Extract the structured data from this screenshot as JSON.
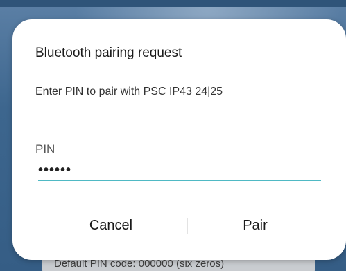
{
  "dialog": {
    "title": "Bluetooth pairing request",
    "message": "Enter PIN to pair with PSC IP43 24|25",
    "pin_label": "PIN",
    "pin_value": "••••••",
    "cancel_label": "Cancel",
    "pair_label": "Pair"
  },
  "background": {
    "footer_text": "Default PIN code: 000000 (six zeros)"
  },
  "colors": {
    "input_underline": "#4fb9c4",
    "dialog_background": "#ffffff",
    "backdrop": "#3f6a93"
  }
}
